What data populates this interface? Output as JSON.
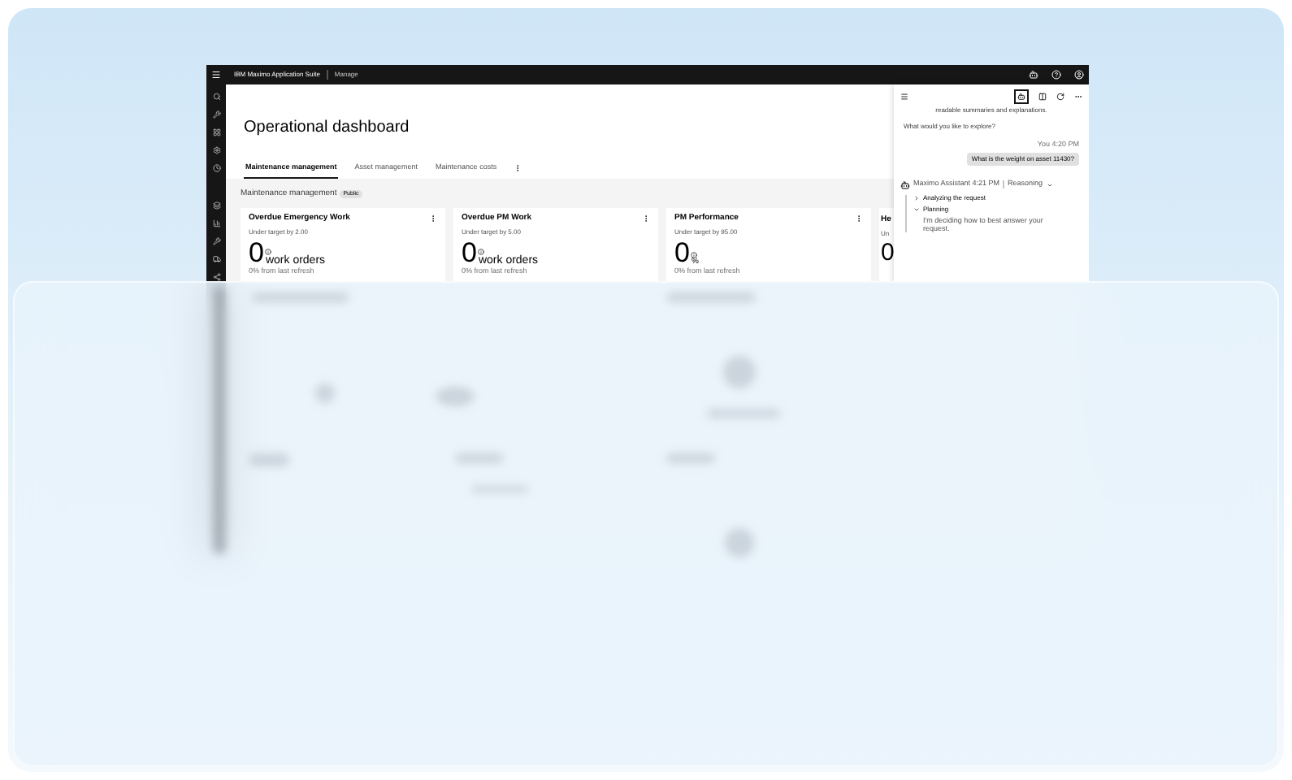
{
  "top_bar": {
    "product": "IBM Maximo Application Suite",
    "app": "Manage"
  },
  "page_title": "Operational dashboard",
  "tabs": [
    {
      "label": "Maintenance management",
      "selected": true
    },
    {
      "label": "Asset management",
      "selected": false
    },
    {
      "label": "Maintenance costs",
      "selected": false
    }
  ],
  "section": {
    "title": "Maintenance management",
    "badge": "Public"
  },
  "cards": [
    {
      "title": "Overdue Emergency Work",
      "target": "Under target by 2.00",
      "value": "0",
      "unit": "work orders",
      "kind": "count",
      "trend": "0% from last refresh"
    },
    {
      "title": "Overdue PM Work",
      "target": "Under target by 5.00",
      "value": "0",
      "unit": "work orders",
      "kind": "count",
      "trend": "0% from last refresh"
    },
    {
      "title": "PM Performance",
      "target": "Under target by 95.00",
      "value": "0",
      "unit": "%",
      "kind": "percent",
      "trend": "0% from last refresh"
    },
    {
      "title": "He",
      "target": "Un",
      "value": "0",
      "kind": "partial"
    }
  ],
  "chat": {
    "intro": "readable summaries and explanations.",
    "prompt": "What would you like to explore?",
    "user_time": "You 4:20 PM",
    "user_message": "What is the weight on asset 11430?",
    "assistant": "Maximo Assistant 4:21 PM",
    "mode": "Reasoning",
    "steps": [
      {
        "label": "Analyzing the request",
        "expanded": false
      },
      {
        "label": "Planning",
        "expanded": true,
        "detail": "I'm deciding how to best answer your request."
      }
    ]
  }
}
